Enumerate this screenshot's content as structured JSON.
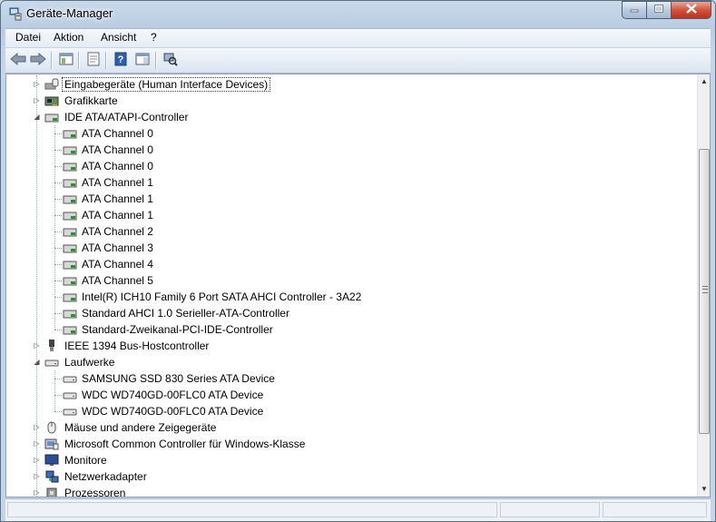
{
  "window": {
    "title": "Geräte-Manager",
    "icon": "device-manager-icon",
    "controls": [
      {
        "name": "minimize-button",
        "icon": "minimize-icon"
      },
      {
        "name": "maximize-button",
        "icon": "maximize-icon"
      },
      {
        "name": "close-button",
        "icon": "close-icon"
      }
    ]
  },
  "menubar": {
    "items": [
      "Datei",
      "Aktion",
      "Ansicht",
      "?"
    ]
  },
  "toolbar": {
    "buttons": [
      {
        "name": "back-button",
        "icon": "arrow-left-icon"
      },
      {
        "name": "forward-button",
        "icon": "arrow-right-icon"
      },
      {
        "name": "show-hide-console-tree-button",
        "icon": "console-tree-icon"
      },
      {
        "name": "properties-button",
        "icon": "properties-icon"
      },
      {
        "name": "help-button",
        "icon": "help-icon"
      },
      {
        "name": "show-action-pane-button",
        "icon": "action-pane-icon"
      },
      {
        "name": "scan-hardware-button",
        "icon": "scan-hardware-icon"
      }
    ]
  },
  "tree": {
    "selected": "Eingabegeräte (Human Interface Devices)",
    "rows": [
      {
        "label": "Eingabegeräte (Human Interface Devices)",
        "level": 1,
        "expander": "collapsed",
        "icon": "hid-icon"
      },
      {
        "label": "Grafikkarte",
        "level": 1,
        "expander": "collapsed",
        "icon": "display-adapter-icon"
      },
      {
        "label": "IDE ATA/ATAPI-Controller",
        "level": 1,
        "expander": "expanded",
        "icon": "ide-controller-icon"
      },
      {
        "label": "ATA Channel 0",
        "level": 2,
        "icon": "ide-channel-icon"
      },
      {
        "label": "ATA Channel 0",
        "level": 2,
        "icon": "ide-channel-icon"
      },
      {
        "label": "ATA Channel 0",
        "level": 2,
        "icon": "ide-channel-icon"
      },
      {
        "label": "ATA Channel 1",
        "level": 2,
        "icon": "ide-channel-icon"
      },
      {
        "label": "ATA Channel 1",
        "level": 2,
        "icon": "ide-channel-icon"
      },
      {
        "label": "ATA Channel 1",
        "level": 2,
        "icon": "ide-channel-icon"
      },
      {
        "label": "ATA Channel 2",
        "level": 2,
        "icon": "ide-channel-icon"
      },
      {
        "label": "ATA Channel 3",
        "level": 2,
        "icon": "ide-channel-icon"
      },
      {
        "label": "ATA Channel 4",
        "level": 2,
        "icon": "ide-channel-icon"
      },
      {
        "label": "ATA Channel 5",
        "level": 2,
        "icon": "ide-channel-icon"
      },
      {
        "label": "Intel(R) ICH10 Family 6 Port SATA AHCI Controller - 3A22",
        "level": 2,
        "icon": "ide-channel-icon"
      },
      {
        "label": "Standard AHCI 1.0 Serieller-ATA-Controller",
        "level": 2,
        "icon": "ide-channel-icon"
      },
      {
        "label": "Standard-Zweikanal-PCI-IDE-Controller",
        "level": 2,
        "icon": "ide-channel-icon"
      },
      {
        "label": "IEEE 1394 Bus-Hostcontroller",
        "level": 1,
        "expander": "collapsed",
        "icon": "ieee1394-icon"
      },
      {
        "label": "Laufwerke",
        "level": 1,
        "expander": "expanded",
        "icon": "disk-drive-icon"
      },
      {
        "label": "SAMSUNG SSD 830 Series ATA Device",
        "level": 2,
        "icon": "disk-drive-icon"
      },
      {
        "label": "WDC WD740GD-00FLC0 ATA Device",
        "level": 2,
        "icon": "disk-drive-icon"
      },
      {
        "label": "WDC WD740GD-00FLC0 ATA Device",
        "level": 2,
        "icon": "disk-drive-icon"
      },
      {
        "label": "Mäuse und andere Zeigegeräte",
        "level": 1,
        "expander": "collapsed",
        "icon": "mouse-icon"
      },
      {
        "label": "Microsoft Common Controller für Windows-Klasse",
        "level": 1,
        "expander": "collapsed",
        "icon": "game-controller-icon"
      },
      {
        "label": "Monitore",
        "level": 1,
        "expander": "collapsed",
        "icon": "monitor-icon"
      },
      {
        "label": "Netzwerkadapter",
        "level": 1,
        "expander": "collapsed",
        "icon": "network-adapter-icon"
      },
      {
        "label": "Prozessoren",
        "level": 1,
        "expander": "collapsed",
        "icon": "processor-icon"
      }
    ]
  },
  "colors": {
    "window_frame": "#b9cde2",
    "selection_focus": "#444444",
    "close_button": "#c1301a"
  }
}
